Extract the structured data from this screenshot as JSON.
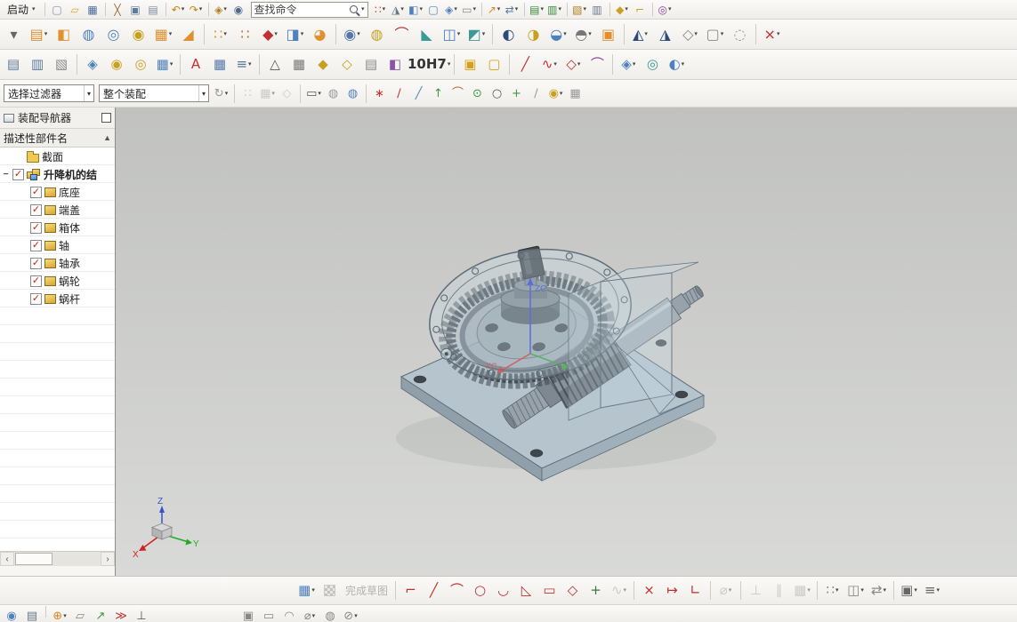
{
  "app": {
    "search_text": "查找命令"
  },
  "toolbars": {
    "row1_left": [
      {
        "t": "menu",
        "n": "start-menu-button",
        "label": "启动"
      },
      {
        "t": "sep"
      },
      {
        "n": "new-file-icon",
        "g": "▢",
        "c": "#7a93ad"
      },
      {
        "n": "open-folder-icon",
        "g": "▱",
        "c": "#d9a33c"
      },
      {
        "n": "save-icon",
        "g": "▦",
        "c": "#4f6f9f"
      },
      {
        "t": "sep"
      },
      {
        "n": "cut-icon",
        "g": "╳",
        "c": "#9a6a3a"
      },
      {
        "n": "copy-icon",
        "g": "▣",
        "c": "#5c7a9c"
      },
      {
        "n": "paste-icon",
        "g": "▤",
        "c": "#7c8ca0"
      },
      {
        "t": "sep"
      },
      {
        "n": "undo-icon",
        "g": "↶",
        "c": "#c8860a",
        "dd": true
      },
      {
        "n": "redo-icon",
        "g": "↷",
        "c": "#c8860a",
        "dd": true
      },
      {
        "t": "sep"
      },
      {
        "n": "command-finder-icon",
        "g": "◈",
        "c": "#b08020",
        "dd": true
      },
      {
        "n": "touch-mode-icon",
        "g": "◉",
        "c": "#4a6a8a"
      }
    ],
    "row1_right": [
      {
        "n": "selection-marquee-icon",
        "g": "∷",
        "c": "#cc4422",
        "dd": true
      },
      {
        "n": "cursor-style-icon",
        "g": "◮",
        "c": "#667788",
        "dd": true
      },
      {
        "n": "shaded-view-icon",
        "g": "◧",
        "c": "#4f81bd",
        "dd": true
      },
      {
        "n": "wireframe-view-icon",
        "g": "▢",
        "c": "#4f81bd"
      },
      {
        "n": "orient-view-icon",
        "g": "◈",
        "c": "#4f81bd",
        "dd": true
      },
      {
        "n": "window-layout-icon",
        "g": "▭",
        "c": "#888888",
        "dd": true
      },
      {
        "t": "sep"
      },
      {
        "n": "move-object-icon",
        "g": "↗",
        "c": "#d4872a",
        "dd": true
      },
      {
        "n": "transform-icon",
        "g": "⇄",
        "c": "#5577aa",
        "dd": true
      },
      {
        "t": "sep"
      },
      {
        "n": "layer-settings-icon",
        "g": "▤",
        "c": "#3a8a3a",
        "dd": true
      },
      {
        "n": "layer-visible-icon",
        "g": "▥",
        "c": "#3a8a3a",
        "dd": true
      },
      {
        "t": "sep"
      },
      {
        "n": "export-icon",
        "g": "▧",
        "c": "#b08020",
        "dd": true
      },
      {
        "n": "print-icon",
        "g": "▥",
        "c": "#667788"
      },
      {
        "t": "sep"
      },
      {
        "n": "key-tool-icon",
        "g": "◆",
        "c": "#caa020",
        "dd": true
      },
      {
        "n": "wrench-tool-icon",
        "g": "⌐",
        "c": "#caa020"
      },
      {
        "t": "sep"
      },
      {
        "n": "macro-icon",
        "g": "◎",
        "c": "#884499",
        "dd": true
      }
    ],
    "row2": [
      {
        "n": "toolbar-options-icon",
        "g": "▾",
        "c": "#666666"
      },
      {
        "n": "datum-plane-icon",
        "g": "▤",
        "c": "#e09030",
        "dd": true
      },
      {
        "n": "block-icon",
        "g": "◧",
        "c": "#e09030"
      },
      {
        "n": "cylinder-icon",
        "g": "◍",
        "c": "#4f81bd"
      },
      {
        "n": "torus-icon",
        "g": "◎",
        "c": "#4f81bd"
      },
      {
        "n": "coil-icon",
        "g": "◉",
        "c": "#c8a020"
      },
      {
        "n": "pattern-blocks-icon",
        "g": "▦",
        "c": "#e09030",
        "dd": true
      },
      {
        "n": "wedge-icon",
        "g": "◢",
        "c": "#e09030"
      },
      {
        "t": "sep"
      },
      {
        "n": "sphere-array-icon",
        "g": "∷",
        "c": "#e09030",
        "dd": true
      },
      {
        "n": "point-array-icon",
        "g": "∷",
        "c": "#c06a28"
      },
      {
        "n": "datum-point-icon",
        "g": "◆",
        "c": "#c03030",
        "dd": true
      },
      {
        "n": "extrude-icon",
        "g": "◨",
        "c": "#4f81bd",
        "dd": true
      },
      {
        "n": "revolve-icon",
        "g": "◕",
        "c": "#e09030"
      },
      {
        "t": "sep"
      },
      {
        "n": "hole-icon",
        "g": "◉",
        "c": "#5577aa",
        "dd": true
      },
      {
        "n": "boss-icon",
        "g": "◍",
        "c": "#c8a020"
      },
      {
        "n": "rib-icon",
        "g": "⌒",
        "c": "#c03030"
      },
      {
        "n": "draft-icon",
        "g": "◣",
        "c": "#3a9a9a"
      },
      {
        "n": "shell-icon",
        "g": "◫",
        "c": "#4f81bd",
        "dd": true
      },
      {
        "n": "trim-body-icon",
        "g": "◩",
        "c": "#3a9a9a",
        "dd": true
      },
      {
        "t": "sep"
      },
      {
        "n": "unite-icon",
        "g": "◐",
        "c": "#2a4a7a"
      },
      {
        "n": "subtract-icon",
        "g": "◑",
        "c": "#c8a020"
      },
      {
        "n": "intersect-icon",
        "g": "◒",
        "c": "#4f81bd",
        "dd": true
      },
      {
        "n": "sew-icon",
        "g": "◓",
        "c": "#777777",
        "dd": true
      },
      {
        "n": "patch-icon",
        "g": "▣",
        "c": "#e09030"
      },
      {
        "t": "sep"
      },
      {
        "n": "move-face-icon",
        "g": "◭",
        "c": "#2a4a7a",
        "dd": true
      },
      {
        "n": "offset-face-icon",
        "g": "◮",
        "c": "#2a4a7a"
      },
      {
        "n": "delete-face-icon",
        "g": "◇",
        "c": "#888888",
        "dd": true
      },
      {
        "n": "replace-face-icon",
        "g": "▢",
        "c": "#888888",
        "dd": true
      },
      {
        "n": "resize-face-icon",
        "g": "◌",
        "c": "#999999"
      },
      {
        "t": "sep"
      },
      {
        "n": "assembly-pattern-icon",
        "g": "×",
        "c": "#c03030",
        "dd": true
      }
    ],
    "row3": [
      {
        "n": "layer-stack-icon",
        "g": "▤",
        "c": "#5a7a9a"
      },
      {
        "n": "layer-stack-2-icon",
        "g": "▥",
        "c": "#5a7a9a"
      },
      {
        "n": "report-icon",
        "g": "▧",
        "c": "#888888"
      },
      {
        "t": "sep"
      },
      {
        "n": "move-component-icon",
        "g": "◈",
        "c": "#4f81bd"
      },
      {
        "n": "assembly-constraints-icon",
        "g": "◉",
        "c": "#caa020"
      },
      {
        "n": "mate-constraint-icon",
        "g": "◎",
        "c": "#caa020"
      },
      {
        "n": "arrangements-icon",
        "g": "▦",
        "c": "#4f81bd",
        "dd": true
      },
      {
        "t": "sep"
      },
      {
        "n": "annotation-icon",
        "g": "A",
        "c": "#c03030"
      },
      {
        "n": "grid-table-icon",
        "g": "▦",
        "c": "#5577aa"
      },
      {
        "n": "sequence-icon",
        "g": "≡",
        "c": "#557799",
        "dd": true
      },
      {
        "t": "sep"
      },
      {
        "n": "tolerance-triangle-icon",
        "g": "△",
        "c": "#555555"
      },
      {
        "n": "check-table-icon",
        "g": "▦",
        "c": "#777777"
      },
      {
        "n": "attach-tool-icon",
        "g": "◆",
        "c": "#caa020"
      },
      {
        "n": "attach-tool-2-icon",
        "g": "◇",
        "c": "#caa020"
      },
      {
        "n": "note-icon",
        "g": "▤",
        "c": "#888888"
      },
      {
        "n": "paint-icon",
        "g": "◧",
        "c": "#8855aa"
      },
      {
        "t": "fit",
        "n": "fit-tolerance-icon",
        "label": "10H7",
        "dd": true
      },
      {
        "t": "sep"
      },
      {
        "n": "gold-block-icon",
        "g": "▣",
        "c": "#d4a017"
      },
      {
        "n": "gold-block-2-icon",
        "g": "▢",
        "c": "#d4a017"
      },
      {
        "t": "sep"
      },
      {
        "n": "line-curve-icon",
        "g": "╱",
        "c": "#c03030"
      },
      {
        "n": "spline-icon",
        "g": "∿",
        "c": "#c03030",
        "dd": true
      },
      {
        "n": "point-polyline-icon",
        "g": "◇",
        "c": "#c03030",
        "dd": true
      },
      {
        "n": "loft-icon",
        "g": "⌒",
        "c": "#884499"
      },
      {
        "t": "sep"
      },
      {
        "n": "surface-icon",
        "g": "◈",
        "c": "#4f81bd",
        "dd": true
      },
      {
        "n": "swept-icon",
        "g": "◎",
        "c": "#3a9a9a"
      },
      {
        "n": "ruled-surface-icon",
        "g": "◐",
        "c": "#4f81bd",
        "dd": true
      }
    ],
    "selection_bar": {
      "filter_value": "选择过滤器",
      "scope_value": "整个装配",
      "icons": [
        {
          "n": "reset-orient-icon",
          "g": "↻",
          "c": "#999999",
          "dd": true
        },
        {
          "t": "sep"
        },
        {
          "n": "snap-toggle-icon",
          "g": "∷",
          "c": "#aaaaaa",
          "dis": true
        },
        {
          "n": "grid-snap-icon",
          "g": "▦",
          "c": "#aaaaaa",
          "dis": true,
          "dd": true
        },
        {
          "n": "plane-snap-icon",
          "g": "◇",
          "c": "#aaaaaa",
          "dis": true
        },
        {
          "t": "sep"
        },
        {
          "n": "marquee-select-icon",
          "g": "▭",
          "c": "#555555",
          "dd": true
        },
        {
          "n": "gray-cylinder-icon",
          "g": "◍",
          "c": "#999999"
        },
        {
          "n": "highlight-cylinder-icon",
          "g": "◍",
          "c": "#4f81bd"
        },
        {
          "t": "sep"
        },
        {
          "n": "snap-point-icon",
          "g": "∗",
          "c": "#cc3333"
        },
        {
          "n": "end-point-icon",
          "g": "∕",
          "c": "#c03030"
        },
        {
          "n": "mid-point-icon",
          "g": "╱",
          "c": "#4f81bd"
        },
        {
          "n": "control-point-icon",
          "g": "↑",
          "c": "#3a9a3a"
        },
        {
          "n": "intersection-point-icon",
          "g": "⌒",
          "c": "#b06a2a"
        },
        {
          "n": "arc-center-icon",
          "g": "⊙",
          "c": "#3a9a3a"
        },
        {
          "n": "quadrant-point-icon",
          "g": "○",
          "c": "#555555"
        },
        {
          "n": "existing-point-icon",
          "g": "+",
          "c": "#3a9a3a"
        },
        {
          "n": "point-on-curve-icon",
          "g": "∕",
          "c": "#999999"
        },
        {
          "n": "point-on-surface-icon",
          "g": "◉",
          "c": "#caa020",
          "dd": true
        },
        {
          "n": "grid-point-icon",
          "g": "▦",
          "c": "#999999"
        }
      ]
    },
    "sketch_bar": [
      {
        "n": "sketch-tools-icon",
        "g": "▦",
        "c": "#4f81bd",
        "dd": true
      },
      {
        "t": "flag",
        "n": "finish-sketch-icon",
        "dis": true
      },
      {
        "t": "label",
        "n": "finish-sketch-label",
        "text": "完成草图",
        "dis": true
      },
      {
        "t": "sep"
      },
      {
        "n": "profile-icon",
        "g": "⌐",
        "c": "#c03030"
      },
      {
        "n": "line-icon",
        "g": "╱",
        "c": "#c03030"
      },
      {
        "n": "arc-icon",
        "g": "⌒",
        "c": "#c03030"
      },
      {
        "n": "circle-icon",
        "g": "○",
        "c": "#c03030"
      },
      {
        "n": "fillet-icon",
        "g": "◡",
        "c": "#c03030"
      },
      {
        "n": "chamfer-icon",
        "g": "◺",
        "c": "#c03030"
      },
      {
        "n": "rectangle-icon",
        "g": "▭",
        "c": "#c03030"
      },
      {
        "n": "polygon-icon",
        "g": "◇",
        "c": "#c03030"
      },
      {
        "n": "point-icon",
        "g": "+",
        "c": "#3a7a3a"
      },
      {
        "n": "offset-curve-icon",
        "g": "∿",
        "c": "#aaaaaa",
        "dis": true,
        "dd": true
      },
      {
        "t": "sep"
      },
      {
        "n": "quick-trim-icon",
        "g": "×",
        "c": "#c03030"
      },
      {
        "n": "quick-extend-icon",
        "g": "↦",
        "c": "#c03030"
      },
      {
        "n": "make-corner-icon",
        "g": "∟",
        "c": "#c03030"
      },
      {
        "t": "sep"
      },
      {
        "n": "rapid-dimension-icon",
        "g": "⌀",
        "c": "#aaaaaa",
        "dis": true,
        "dd": true
      },
      {
        "t": "sep"
      },
      {
        "n": "geometric-constraints-icon",
        "g": "⊥",
        "c": "#aaaaaa",
        "dis": true
      },
      {
        "n": "auto-constrain-icon",
        "g": "∥",
        "c": "#aaaaaa",
        "dis": true
      },
      {
        "n": "show-constraints-icon",
        "g": "▦",
        "c": "#aaaaaa",
        "dis": true,
        "dd": true
      },
      {
        "t": "sep"
      },
      {
        "n": "pattern-curve-icon",
        "g": "∷",
        "c": "#888888",
        "dd": true
      },
      {
        "n": "mirror-curve-icon",
        "g": "◫",
        "c": "#888888",
        "dd": true
      },
      {
        "n": "alternate-solution-icon",
        "g": "⇄",
        "c": "#888888",
        "dd": true
      },
      {
        "t": "sep"
      },
      {
        "n": "relations-browser-icon",
        "g": "▣",
        "c": "#666666",
        "dd": true
      },
      {
        "n": "sketch-settings-icon",
        "g": "≡",
        "c": "#666666",
        "dd": true
      }
    ],
    "bottom_row": [
      {
        "n": "touch-icon",
        "g": "◉",
        "c": "#4f81bd"
      },
      {
        "n": "keyboard-icon",
        "g": "▤",
        "c": "#667788"
      },
      {
        "t": "sep"
      },
      {
        "n": "datum-csys-icon",
        "g": "⊕",
        "c": "#d4872a",
        "dd": true
      },
      {
        "n": "plane-tool-icon",
        "g": "▱",
        "c": "#888888"
      },
      {
        "n": "vector-tool-icon",
        "g": "↗",
        "c": "#3a9a3a"
      },
      {
        "n": "flags-icon",
        "g": "≫",
        "c": "#c03030"
      },
      {
        "n": "perpendicular-tool-icon",
        "g": "⊥",
        "c": "#555555"
      },
      {
        "t": "gap",
        "w": 96
      },
      {
        "n": "cube-tool-icon",
        "g": "▣",
        "c": "#888888"
      },
      {
        "n": "panel-tool-icon",
        "g": "▭",
        "c": "#888888"
      },
      {
        "n": "lock-tool-icon",
        "g": "◠",
        "c": "#888888"
      },
      {
        "n": "diameter-tool-icon",
        "g": "⌀",
        "c": "#888888",
        "dd": true
      },
      {
        "n": "cylinder-tool-icon",
        "g": "◍",
        "c": "#888888"
      },
      {
        "n": "section-tool-icon",
        "g": "⊘",
        "c": "#888888",
        "dd": true
      }
    ]
  },
  "navigator": {
    "title": "装配导航器",
    "column_header": "描述性部件名",
    "sort_glyph": "▲",
    "check_glyph": "✓",
    "scroll_prev": "‹",
    "scroll_next": "›",
    "tree": [
      {
        "type": "folder",
        "label": "截面"
      },
      {
        "type": "assembly",
        "label": "升降机的结",
        "expander": "−",
        "checked": true,
        "bold": true
      },
      {
        "type": "part",
        "label": "底座",
        "checked": true
      },
      {
        "type": "part",
        "label": "端盖",
        "checked": true
      },
      {
        "type": "part",
        "label": "箱体",
        "checked": true
      },
      {
        "type": "part",
        "label": "轴",
        "checked": true
      },
      {
        "type": "part",
        "label": "轴承",
        "checked": true
      },
      {
        "type": "part",
        "label": "蜗轮",
        "checked": true
      },
      {
        "type": "part",
        "label": "蜗杆",
        "checked": true
      }
    ]
  },
  "viewport": {
    "wcs_z": "ZC",
    "wcs_x": "XC",
    "triad_x": "X",
    "triad_y": "Y",
    "triad_z": "Z"
  }
}
